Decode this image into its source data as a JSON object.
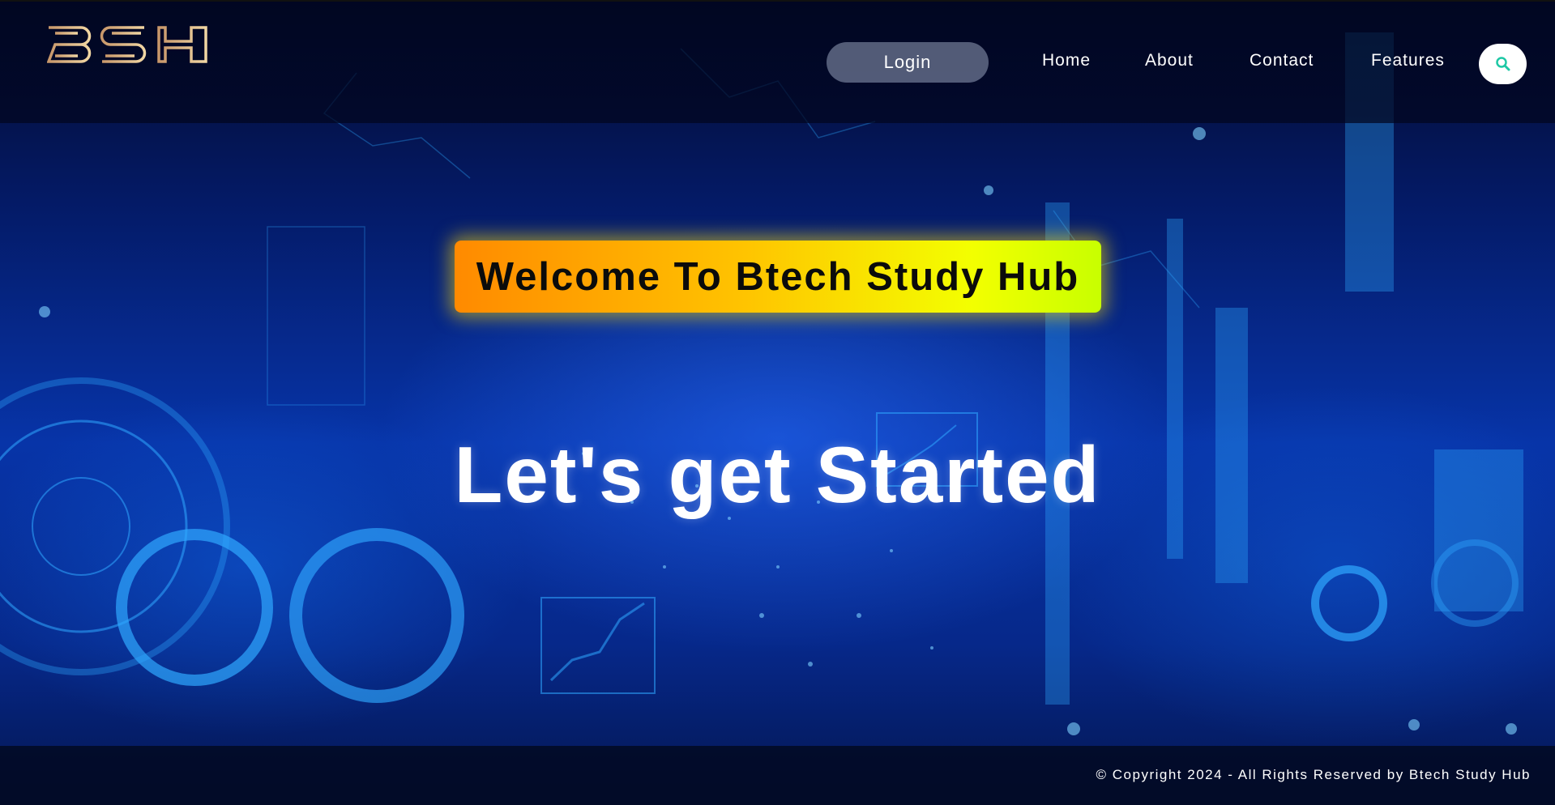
{
  "brand": {
    "logo_text": "BSH"
  },
  "nav": {
    "login_label": "Login",
    "links": [
      "Home",
      "About",
      "Contact",
      "Features"
    ],
    "search_icon": "search-icon"
  },
  "hero": {
    "welcome": "Welcome To Btech Study Hub",
    "title": "Let's get Started"
  },
  "footer": {
    "copyright": "© Copyright 2024 - All Rights Reserved by Btech Study Hub"
  },
  "colors": {
    "logo_gold": "#d9b27a",
    "search_icon": "#1ec8a5",
    "badge_start": "#ff8a00",
    "badge_end": "#c8ff00"
  }
}
